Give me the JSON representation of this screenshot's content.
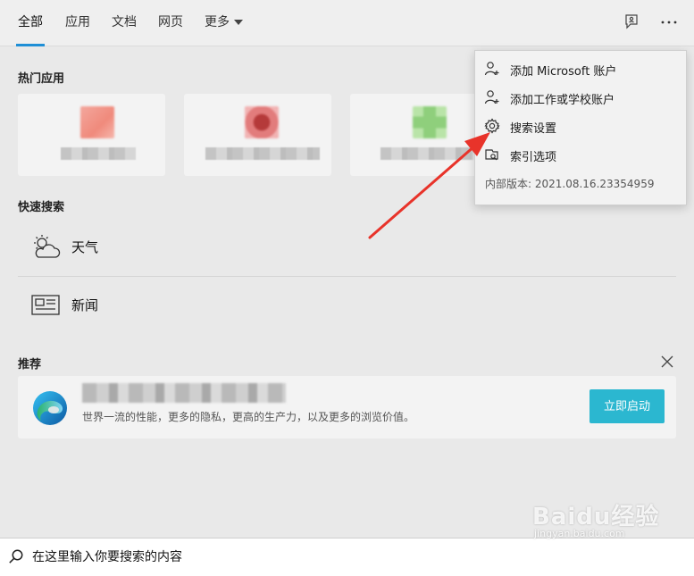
{
  "nav": {
    "tabs": [
      {
        "label": "全部",
        "active": true
      },
      {
        "label": "应用"
      },
      {
        "label": "文档"
      },
      {
        "label": "网页"
      },
      {
        "label": "更多"
      }
    ]
  },
  "hot_apps": {
    "title": "热门应用"
  },
  "quick_search": {
    "title": "快速搜索",
    "items": [
      {
        "label": "天气",
        "icon": "weather-icon"
      },
      {
        "label": "新闻",
        "icon": "news-icon"
      }
    ]
  },
  "recommend": {
    "title": "推荐",
    "description": "世界一流的性能，更多的隐私，更高的生产力，以及更多的浏览价值。",
    "button_label": "立即启动",
    "accent": "#2bb7d0"
  },
  "menu": {
    "items": [
      {
        "label": "添加 Microsoft 账户",
        "icon": "add-user-icon"
      },
      {
        "label": "添加工作或学校账户",
        "icon": "add-user-icon"
      },
      {
        "label": "搜索设置",
        "icon": "gear-icon"
      },
      {
        "label": "索引选项",
        "icon": "index-icon"
      }
    ],
    "version": "内部版本: 2021.08.16.23354959"
  },
  "search": {
    "placeholder": "在这里输入你要搜索的内容"
  },
  "watermark": {
    "logo": "Baidu经验",
    "url": "jingyan.baidu.com"
  },
  "colors": {
    "tab_underline": "#1f8fd6",
    "annotation_arrow": "#e8332a"
  }
}
